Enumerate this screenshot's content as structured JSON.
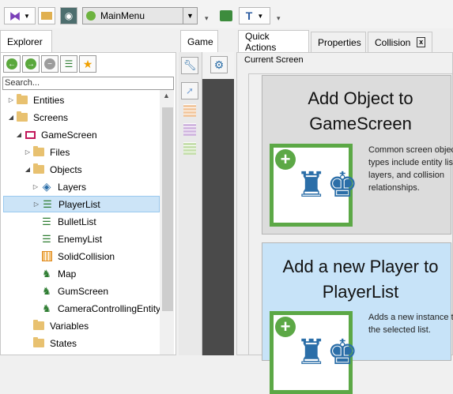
{
  "toolbar": {
    "combo_value": "MainMenu",
    "vs_icon": "visual-studio-icon",
    "folder_icon": "folder-icon",
    "camera_icon": "camera-icon",
    "play_icon": "play-icon",
    "layers_icon": "layers-icon",
    "tool_icon": "t-tool-icon"
  },
  "explorer": {
    "tab_label": "Explorer",
    "search_placeholder": "Search...",
    "tree": [
      {
        "label": "Entities",
        "icon": "folder"
      },
      {
        "label": "Screens",
        "icon": "folder"
      },
      {
        "label": "GameScreen",
        "icon": "screen"
      },
      {
        "label": "Files",
        "icon": "folder"
      },
      {
        "label": "Objects",
        "icon": "folder"
      },
      {
        "label": "Layers",
        "icon": "layers"
      },
      {
        "label": "PlayerList",
        "icon": "list"
      },
      {
        "label": "BulletList",
        "icon": "list"
      },
      {
        "label": "EnemyList",
        "icon": "list"
      },
      {
        "label": "SolidCollision",
        "icon": "collision"
      },
      {
        "label": "Map",
        "icon": "map"
      },
      {
        "label": "GumScreen",
        "icon": "map"
      },
      {
        "label": "CameraControllingEntity",
        "icon": "map"
      },
      {
        "label": "Variables",
        "icon": "folder"
      },
      {
        "label": "States",
        "icon": "folder"
      }
    ]
  },
  "game": {
    "tab_label": "Game"
  },
  "right": {
    "tabs": [
      "Quick Actions",
      "Properties",
      "Collision"
    ],
    "close_glyph": "x",
    "section_label": "Current Screen",
    "cards": [
      {
        "title": "Add Object to GameScreen",
        "desc": "Common screen object types include entity lists, layers, and collision relationships."
      },
      {
        "title": "Add a new Player to PlayerList",
        "desc": "Adds a new instance to the selected list."
      }
    ]
  },
  "colors": {
    "accent_green": "#5ca846",
    "selection": "#cce4f7",
    "card_blue": "#c7e3f8",
    "card_gray": "#dcdcdc"
  }
}
